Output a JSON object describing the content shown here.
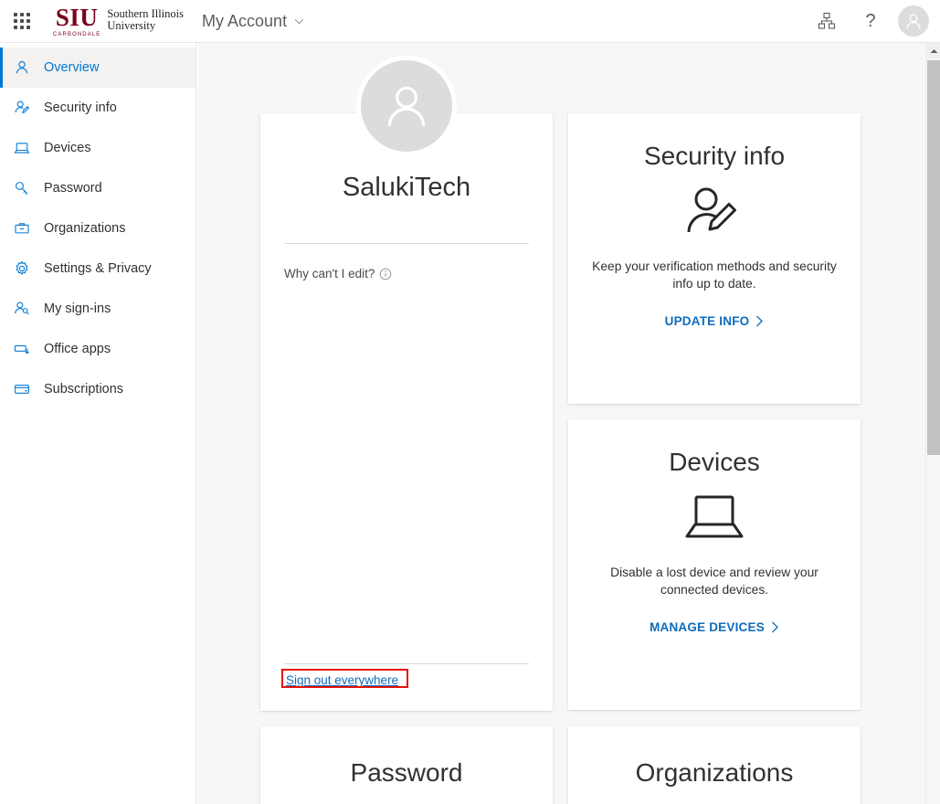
{
  "header": {
    "waffle_label": "App launcher",
    "logo": {
      "siu_main": "SIU",
      "siu_sub": "CARBONDALE",
      "line1": "Southern Illinois",
      "line2": "University"
    },
    "my_account": "My Account",
    "icons": {
      "chevron": "chevron-down-icon",
      "org": "org-hierarchy-icon",
      "help": "?",
      "avatar": "user-avatar-icon"
    }
  },
  "sidebar": {
    "items": [
      {
        "label": "Overview",
        "icon": "person-icon",
        "active": true
      },
      {
        "label": "Security info",
        "icon": "person-edit-icon",
        "active": false
      },
      {
        "label": "Devices",
        "icon": "laptop-icon",
        "active": false
      },
      {
        "label": "Password",
        "icon": "key-icon",
        "active": false
      },
      {
        "label": "Organizations",
        "icon": "briefcase-icon",
        "active": false
      },
      {
        "label": "Settings & Privacy",
        "icon": "gear-icon",
        "active": false
      },
      {
        "label": "My sign-ins",
        "icon": "person-search-icon",
        "active": false
      },
      {
        "label": "Office apps",
        "icon": "app-download-icon",
        "active": false
      },
      {
        "label": "Subscriptions",
        "icon": "card-icon",
        "active": false
      }
    ]
  },
  "profile": {
    "name": "SalukiTech",
    "why_edit": "Why can't I edit?",
    "why_edit_icon": "info-icon",
    "sign_out": "Sign out everywhere",
    "annotation_color": "#e8120a"
  },
  "cards": {
    "security": {
      "title": "Security info",
      "icon": "person-edit-icon",
      "desc": "Keep your verification methods and security info up to date.",
      "link": "UPDATE INFO"
    },
    "devices": {
      "title": "Devices",
      "icon": "laptop-icon",
      "desc": "Disable a lost device and review your connected devices.",
      "link": "MANAGE DEVICES"
    },
    "password": {
      "title": "Password",
      "icon": "key-icon"
    },
    "organizations": {
      "title": "Organizations",
      "icon": "briefcase-icon"
    }
  },
  "colors": {
    "accent": "#0078d4",
    "link": "#0f6cbd",
    "brand_maroon": "#7a0019",
    "canvas": "#f7f7f7",
    "annotation": "#e8120a"
  },
  "scrollbar": {
    "arrow_up": "scroll-up-arrow"
  }
}
